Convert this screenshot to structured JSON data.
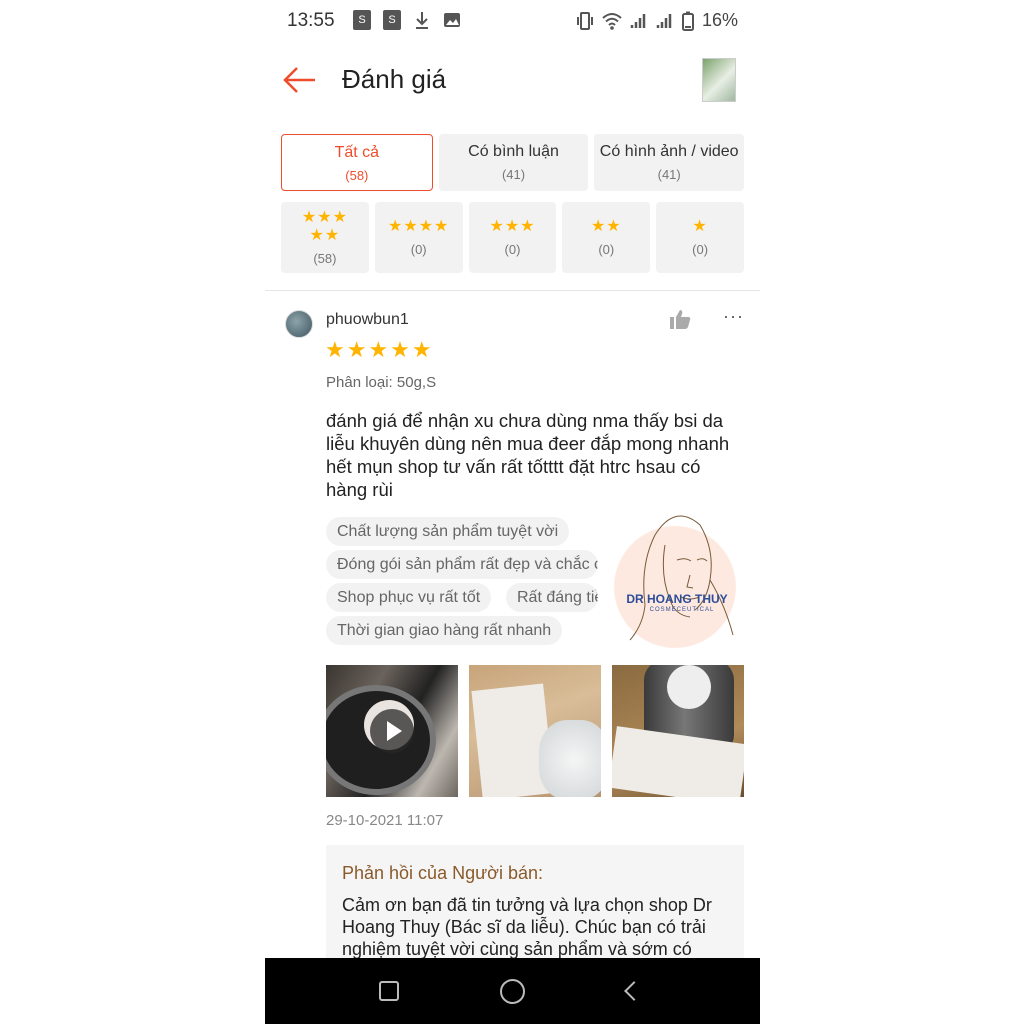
{
  "status_bar": {
    "time": "13:55",
    "battery": "16%"
  },
  "header": {
    "title": "Đánh giá"
  },
  "tabs": [
    {
      "label": "Tất cả",
      "count": "(58)"
    },
    {
      "label": "Có bình luận",
      "count": "(41)"
    },
    {
      "label": "Có hình ảnh / video",
      "count": "(41)"
    }
  ],
  "star_filters": [
    {
      "stars_line1": "★★★",
      "stars_line2": "★★",
      "count": "(58)"
    },
    {
      "stars_line1": "★★★★",
      "stars_line2": "",
      "count": "(0)"
    },
    {
      "stars_line1": "★★★",
      "stars_line2": "",
      "count": "(0)"
    },
    {
      "stars_line1": "★★",
      "stars_line2": "",
      "count": "(0)"
    },
    {
      "stars_line1": "★",
      "stars_line2": "",
      "count": "(0)"
    }
  ],
  "review": {
    "username": "phuowbun1",
    "stars": "★★★★★",
    "rating": 5,
    "variant": "Phân loại: 50g,S",
    "text": "đánh giá để nhận xu chưa dùng nma thấy bsi da liễu khuyên dùng nên mua đeer đắp mong nhanh hết mụn shop tư vấn rất tốtttt đặt htrc hsau có hàng rùi",
    "tags": [
      "Chất lượng sản phẩm tuyệt vời",
      "Đóng gói sản phẩm rất đẹp và chắc chắn",
      "Shop phục vụ rất tốt",
      "Rất đáng tiền",
      "Thời gian giao hàng rất nhanh"
    ],
    "date": "29-10-2021 11:07",
    "more": "···"
  },
  "logo": {
    "brand": "DR HOANG THUY",
    "sub": "COSMECEUTICAL"
  },
  "seller_reply": {
    "heading": "Phản hồi của Người bán:",
    "body": "Cảm ơn bạn đã tin tưởng và lựa chọn shop Dr Hoang Thuy (Bác sĩ da liễu). Chúc bạn có trải nghiệm tuyệt vời cùng sản phẩm và sớm có"
  },
  "icons": [
    "back-arrow-icon",
    "like-icon",
    "more-icon",
    "play-icon",
    "recent-apps-icon",
    "home-icon",
    "nav-back-icon"
  ],
  "colors": {
    "accent": "#ee4d2d",
    "star": "#ffb400",
    "reply_heading": "#8a5a2b"
  }
}
